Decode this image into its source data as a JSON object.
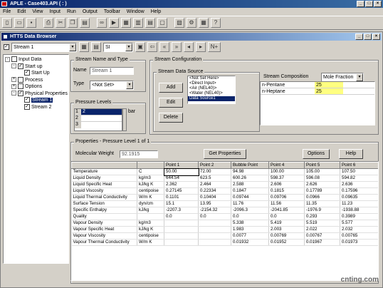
{
  "app": {
    "title": "APLE - Case403.API  ( : )"
  },
  "menu": [
    "File",
    "Edit",
    "View",
    "Input",
    "Run",
    "Output",
    "Toolbar",
    "Window",
    "Help"
  ],
  "window": {
    "title": "HTTS Data Browser"
  },
  "subtoolbar": {
    "stream_select": "Stream 1",
    "units_select": "SI",
    "nav_last": "N+"
  },
  "tree": {
    "items": [
      {
        "label": "Input Data",
        "level": 0,
        "checked": false,
        "expand": "-"
      },
      {
        "label": "Start up",
        "level": 1,
        "checked": true,
        "expand": "-"
      },
      {
        "label": "Start Up",
        "level": 2,
        "checked": true,
        "expand": ""
      },
      {
        "label": "Process",
        "level": 1,
        "checked": false,
        "expand": "+"
      },
      {
        "label": "Options",
        "level": 1,
        "checked": false,
        "expand": "+"
      },
      {
        "label": "Physical Properties",
        "level": 1,
        "checked": true,
        "expand": "-"
      },
      {
        "label": "Stream 1",
        "level": 2,
        "checked": true,
        "expand": "",
        "selected": true
      },
      {
        "label": "Stream 2",
        "level": 2,
        "checked": true,
        "expand": ""
      }
    ]
  },
  "stream_name": {
    "group_title": "Stream Name and Type",
    "name_label": "Name",
    "name_value": "Stream 1",
    "type_label": "Type",
    "type_value": "<Not Set>"
  },
  "pressure": {
    "group_title": "Pressure Levels",
    "rows": [
      {
        "n": "1",
        "v": "2"
      },
      {
        "n": "2",
        "v": ""
      },
      {
        "n": "3",
        "v": ""
      }
    ],
    "unit": "bar"
  },
  "config": {
    "group_title": "Stream Configuration",
    "source_title": "Stream Data Source",
    "add": "Add",
    "edit": "Edit",
    "delete": "Delete",
    "sources": [
      "<Not Set Here>",
      "<Direct Input>",
      "<Air (NEL40)>",
      "<Water (NEL40)>",
      "Data Source1"
    ],
    "selected_source": 4,
    "composition_title": "Stream Composition",
    "composition_type": "Mole Fraction",
    "components": [
      {
        "name": "n-Pentane",
        "value": "25"
      },
      {
        "name": "n-Heptane",
        "value": "25"
      }
    ]
  },
  "properties": {
    "title": "Properties - Pressure Level 1 of 1",
    "mw_label": "Molecular Weight",
    "mw_value": "92.1915",
    "get_props": "Get Properties",
    "options": "Options",
    "help": "Help"
  },
  "table": {
    "headers": [
      "",
      "",
      "Point 1",
      "Point 2",
      "Bubble Point",
      "Point 4",
      "Point 5",
      "Point 6"
    ],
    "rows": [
      [
        "Temperature",
        "C",
        "50.00",
        "72.00",
        "94.98",
        "100.00",
        "105.00",
        "107.50"
      ],
      [
        "Liquid Density",
        "kg/m3",
        "644.54",
        "623.5",
        "600.26",
        "598.37",
        "596.08",
        "594.82"
      ],
      [
        "Liquid Specific Heat",
        "kJ/kg K",
        "2.362",
        "2.464",
        "2.588",
        "2.606",
        "2.626",
        "2.636"
      ],
      [
        "Liquid Viscosity",
        "centipoise",
        "0.27145",
        "0.22334",
        "0.1847",
        "0.1815",
        "0.17789",
        "0.17596"
      ],
      [
        "Liquid Thermal Conductivity",
        "W/m K",
        "0.1101",
        "0.10404",
        "0.09744",
        "0.09706",
        "0.0966",
        "0.09635"
      ],
      [
        "Surface Tension",
        "dyn/cm",
        "15.1",
        "13.95",
        "11.76",
        "11.56",
        "11.35",
        "11.23"
      ],
      [
        "Specific Enthalpy",
        "kJ/kg",
        "-2207.3",
        "-2154.32",
        "-2096.3",
        "-2041.85",
        "-1976.9",
        "-1938.88"
      ],
      [
        "Quality",
        "",
        "0.0",
        "0.0",
        "0.0",
        "0.0",
        "0.293",
        "0.3989"
      ],
      [
        "Vapour Density",
        "kg/m3",
        "",
        "",
        "5.338",
        "5.419",
        "5.519",
        "5.577"
      ],
      [
        "Vapour Specific Heat",
        "kJ/kg K",
        "",
        "",
        "1.983",
        "2.003",
        "2.022",
        "2.032"
      ],
      [
        "Vapour Viscosity",
        "centipoise",
        "",
        "",
        "0.0077",
        "0.00769",
        "0.00767",
        "0.00765"
      ],
      [
        "Vapour Thermal Conductivity",
        "W/m K",
        "",
        "",
        "0.01932",
        "0.01952",
        "0.01967",
        "0.01973"
      ]
    ]
  },
  "watermark": "cnting.com",
  "colors": {
    "title_dark": "#0a246a",
    "title_light": "#3a6ea5",
    "composition_fill": "#ffff80"
  }
}
